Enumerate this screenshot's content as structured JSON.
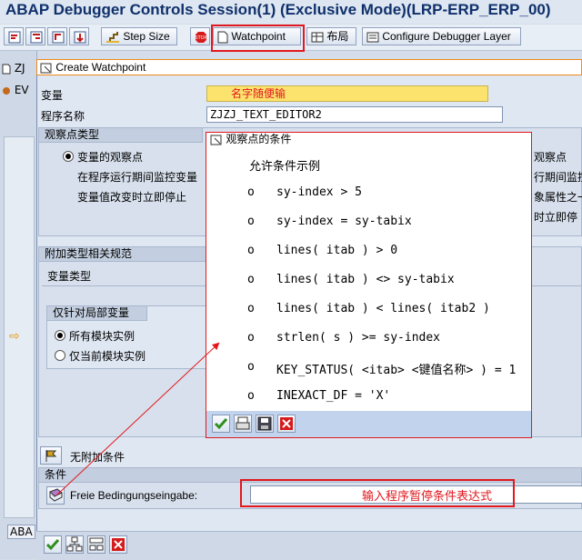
{
  "window": {
    "title": "ABAP Debugger Controls Session(1)  (Exclusive Mode)(LRP-ERP_ERP_00)"
  },
  "toolbar": {
    "step_size": "Step Size",
    "watchpoint": "Watchpoint",
    "layout": "布局",
    "configure": "Configure Debugger Layer"
  },
  "left_strip": {
    "zj": "ZJ",
    "ev": "EV",
    "ab": "ABA"
  },
  "dialog": {
    "title": "Create Watchpoint",
    "variable_label": "变量",
    "variable_hint": "名字随便输",
    "program_label": "程序名称",
    "program_value": "ZJZJ_TEXT_EDITOR2",
    "watch_type": {
      "header": "观察点类型",
      "option1": "变量的观察点",
      "desc1": "在程序运行期间监控变量",
      "desc2": "变量值改变时立即停止",
      "right_cut1": "观察点",
      "right_cut2": "行期间监控",
      "right_cut3": "象属性之一",
      "right_cut4": "时立即停"
    },
    "additional": {
      "header": "附加类型相关规范",
      "var_type_label": "变量类型",
      "local_group": "仅针对局部变量",
      "opt_all": "所有模块实例",
      "opt_current": "仅当前模块实例"
    },
    "no_condition": "无附加条件",
    "condition": {
      "header": "条件",
      "free_label": "Freie Bedingungseingabe:",
      "input_hint": "输入程序暂停条件表达式"
    }
  },
  "popup": {
    "title": "观察点的条件",
    "heading": "允许条件示例",
    "lines": [
      {
        "bullet": "o",
        "text": "sy-index > 5"
      },
      {
        "bullet": "o",
        "text": "sy-index = sy-tabix"
      },
      {
        "bullet": "o",
        "text": "lines( itab ) > 0"
      },
      {
        "bullet": "o",
        "text": "lines( itab ) <> sy-tabix"
      },
      {
        "bullet": "o",
        "text": "lines( itab ) < lines( itab2 )"
      },
      {
        "bullet": "o",
        "text": "strlen( s ) >= sy-index"
      },
      {
        "bullet": "o",
        "text": "KEY_STATUS( <itab> <键值名称> ) = 1"
      },
      {
        "bullet": "o",
        "text": "INEXACT_DF = 'X'"
      }
    ]
  },
  "colors": {
    "annotation_red": "#e2181e",
    "title_blue": "#10306b",
    "popup_toolbar": "#c2d3ee"
  }
}
